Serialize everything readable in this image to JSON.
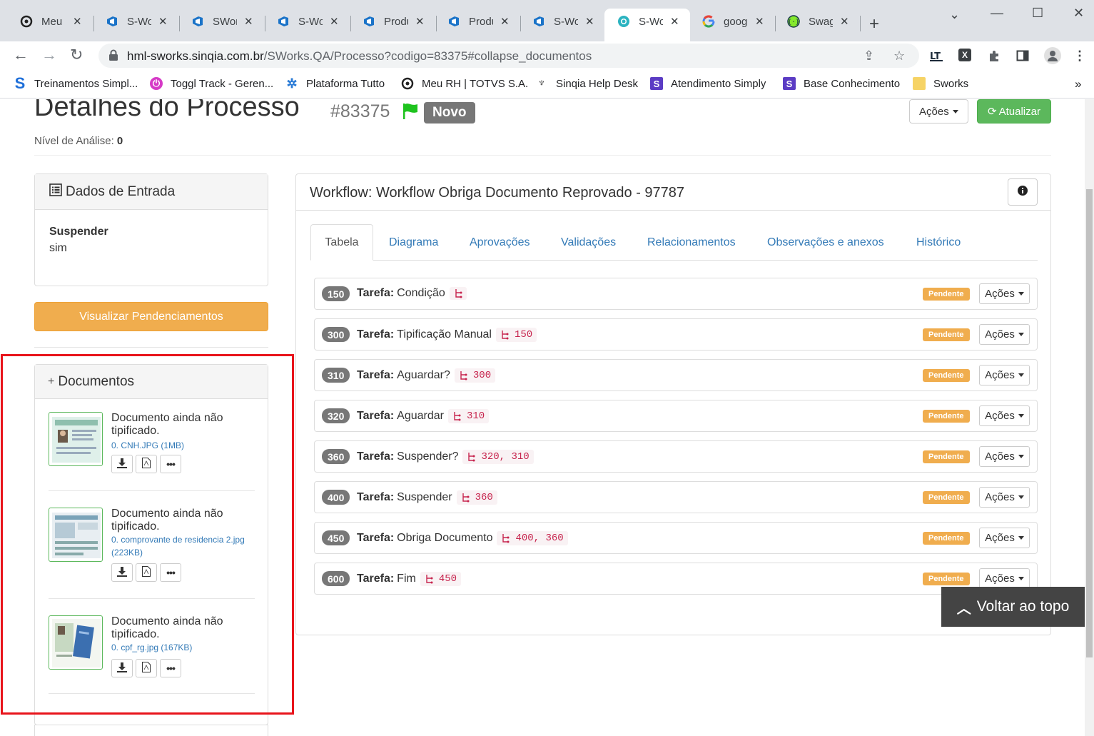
{
  "browser": {
    "tabs": [
      {
        "label": "Meu F",
        "icon": "totvs-icon",
        "active": false
      },
      {
        "label": "S-Wor",
        "icon": "azure-devops-icon",
        "active": false
      },
      {
        "label": "SWorl",
        "icon": "azure-devops-icon",
        "active": false
      },
      {
        "label": "S-Wor",
        "icon": "azure-devops-icon",
        "active": false
      },
      {
        "label": "Produ",
        "icon": "azure-devops-icon",
        "active": false
      },
      {
        "label": "Produ",
        "icon": "azure-devops-icon",
        "active": false
      },
      {
        "label": "S-Wor",
        "icon": "azure-devops-icon",
        "active": false
      },
      {
        "label": "S-Wor",
        "icon": "sworks-icon",
        "active": true
      },
      {
        "label": "googl",
        "icon": "google-icon",
        "active": false
      },
      {
        "label": "Swag",
        "icon": "swagger-icon",
        "active": false
      }
    ],
    "new_tab": "+",
    "url_host": "hml-sworks.sinqia.com.br",
    "url_path": "/SWorks.QA/Processo?codigo=83375#collapse_documentos",
    "bookmarks": [
      {
        "label": "Treinamentos Simpl...",
        "icon": "simply-s-icon"
      },
      {
        "label": "Toggl Track - Geren...",
        "icon": "toggl-icon"
      },
      {
        "label": "Plataforma Tutto",
        "icon": "tutto-icon"
      },
      {
        "label": "Meu RH | TOTVS S.A.",
        "icon": "totvs-icon"
      },
      {
        "label": "Sinqia Help Desk",
        "icon": "helpdesk-icon"
      },
      {
        "label": "Atendimento Simply",
        "icon": "simply-s-icon"
      },
      {
        "label": "Base Conhecimento",
        "icon": "simply-s-icon"
      },
      {
        "label": "Sworks",
        "icon": "folder-icon"
      }
    ],
    "bookmarks_overflow": "»"
  },
  "header": {
    "title": "Detalhes do Processo",
    "process_number": "#83375",
    "status_badge": "Novo",
    "acoes_label": "Ações",
    "atualizar_label": "Atualizar",
    "nivel_label": "Nível de Análise:",
    "nivel_value": "0"
  },
  "dados_entrada": {
    "title": "Dados de Entrada",
    "field_label": "Suspender",
    "field_value": "sim"
  },
  "visualizar_label": "Visualizar Pendenciamentos",
  "documentos": {
    "title": "Documentos",
    "items": [
      {
        "title": "Documento ainda não tipificado.",
        "file": "0. CNH.JPG (1MB)"
      },
      {
        "title": "Documento ainda não tipificado.",
        "file": "0. comprovante de residencia 2.jpg (223KB)"
      },
      {
        "title": "Documento ainda não tipificado.",
        "file": "0. cpf_rg.jpg (167KB)"
      }
    ]
  },
  "workflow": {
    "title": "Workflow: Workflow Obriga Documento Reprovado - 97787",
    "tabs": [
      "Tabela",
      "Diagrama",
      "Aprovações",
      "Validações",
      "Relacionamentos",
      "Observações e anexos",
      "Histórico"
    ],
    "task_prefix": "Tarefa:",
    "tasks": [
      {
        "num": "150",
        "name": "Condição",
        "deps": "",
        "status": "Pendente",
        "acoes": "Ações"
      },
      {
        "num": "300",
        "name": "Tipificação Manual",
        "deps": "150",
        "status": "Pendente",
        "acoes": "Ações"
      },
      {
        "num": "310",
        "name": "Aguardar?",
        "deps": "300",
        "status": "Pendente",
        "acoes": "Ações"
      },
      {
        "num": "320",
        "name": "Aguardar",
        "deps": "310",
        "status": "Pendente",
        "acoes": "Ações"
      },
      {
        "num": "360",
        "name": "Suspender?",
        "deps": "320, 310",
        "status": "Pendente",
        "acoes": "Ações"
      },
      {
        "num": "400",
        "name": "Suspender",
        "deps": "360",
        "status": "Pendente",
        "acoes": "Ações"
      },
      {
        "num": "450",
        "name": "Obriga Documento",
        "deps": "400, 360",
        "status": "Pendente",
        "acoes": "Ações"
      },
      {
        "num": "600",
        "name": "Fim",
        "deps": "450",
        "status": "Pendente",
        "acoes": "Ações"
      }
    ]
  },
  "voltar_label": "Voltar ao topo",
  "colors": {
    "accent": "#337ab7",
    "success": "#5cb85c",
    "warning": "#f0ad4e",
    "highlight": "#e8141b"
  }
}
